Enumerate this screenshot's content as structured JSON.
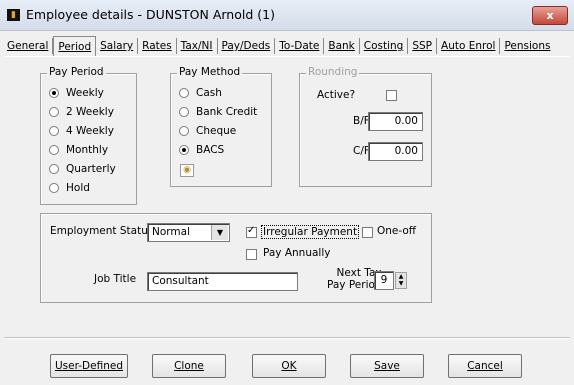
{
  "window": {
    "title": "Employee details - DUNSTON Arnold (1)",
    "app_icon": "chart-icon",
    "close": "x"
  },
  "tabs": [
    {
      "label": "General"
    },
    {
      "label": "Period"
    },
    {
      "label": "Salary"
    },
    {
      "label": "Rates"
    },
    {
      "label": "Tax/NI"
    },
    {
      "label": "Pay/Deds"
    },
    {
      "label": "To-Date"
    },
    {
      "label": "Bank"
    },
    {
      "label": "Costing"
    },
    {
      "label": "SSP"
    },
    {
      "label": "Auto Enrol"
    },
    {
      "label": "Pensions"
    }
  ],
  "active_tab": "Period",
  "pay_period": {
    "title": "Pay Period",
    "options": [
      "Weekly",
      "2 Weekly",
      "4 Weekly",
      "Monthly",
      "Quarterly",
      "Hold"
    ],
    "selected": "Weekly"
  },
  "pay_method": {
    "title": "Pay Method",
    "options": [
      "Cash",
      "Bank Credit",
      "Cheque",
      "BACS"
    ],
    "selected": "BACS"
  },
  "rounding": {
    "title": "Rounding",
    "active_label": "Active?",
    "bf_label": "B/F",
    "bf_value": "0.00",
    "cf_label": "C/F",
    "cf_value": "0.00"
  },
  "employment": {
    "status_label": "Employment Status",
    "status_value": "Normal",
    "irregular_label": "Irregular Payment",
    "one_off_label": "One-off",
    "pay_annually_label": "Pay Annually",
    "job_title_label": "Job Title",
    "job_title_value": "Consultant",
    "next_tax_label_1": "Next Tax",
    "next_tax_label_2": "Pay Period",
    "next_tax_value": "9"
  },
  "buttons": {
    "user_defined": "User-Defined",
    "clone": "Clone",
    "ok": "OK",
    "save": "Save",
    "cancel": "Cancel"
  }
}
